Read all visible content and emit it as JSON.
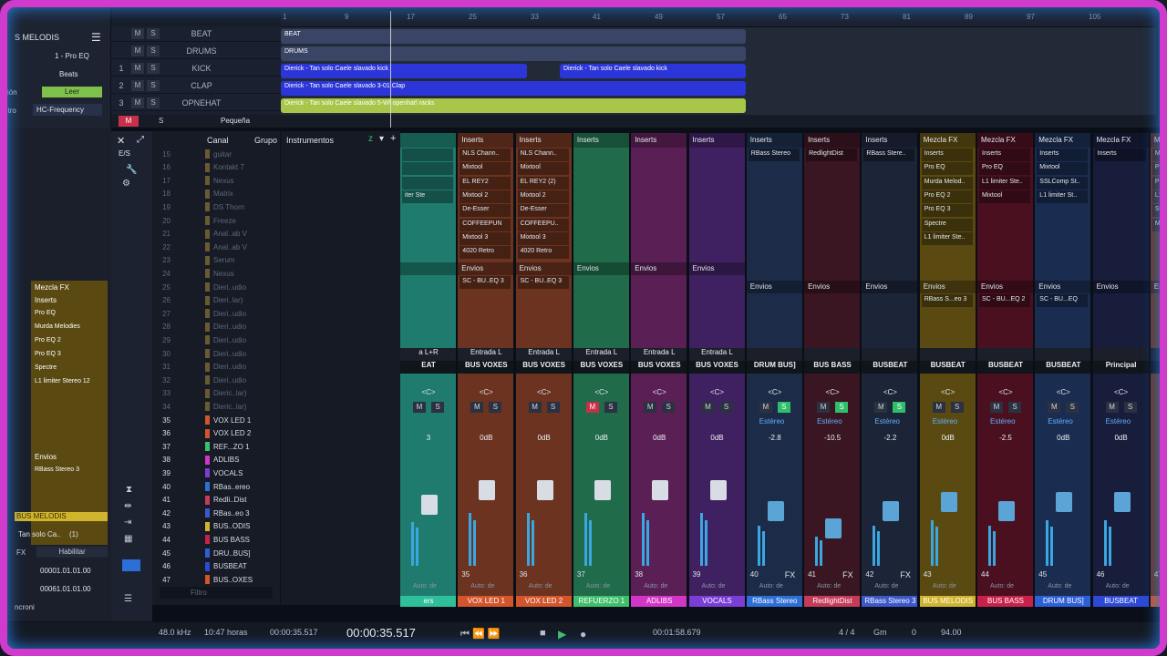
{
  "arrange": {
    "inspector": {
      "title": "S MELODIS",
      "preset": "1 - Pro EQ",
      "beats": "Beats",
      "leer": "Leer",
      "section": "ción",
      "freq_label": "etro",
      "freq": "HC-Frequency"
    },
    "tracks": [
      {
        "num": "",
        "name": "BEAT"
      },
      {
        "num": "",
        "name": "DRUMS"
      },
      {
        "num": "1",
        "name": "KICK"
      },
      {
        "num": "2",
        "name": "CLAP"
      },
      {
        "num": "3",
        "name": "OPNEHAT"
      }
    ],
    "small_label": "Pequeña",
    "ruler": [
      "1",
      "9",
      "17",
      "25",
      "33",
      "41",
      "49",
      "57",
      "65",
      "73",
      "81",
      "89",
      "97",
      "105"
    ],
    "clips": [
      {
        "label": "BEAT"
      },
      {
        "label": "DRUMS"
      },
      {
        "label": "Dierick - Tan solo Caele slavado kick"
      },
      {
        "label": "Dierick - Tan solo Caele slavado kick"
      },
      {
        "label": "Dierick - Tan solo Caele slavado 3-01 Clap"
      },
      {
        "label": "Dierick - Tan solo Caele slavado 5-W\\ openhat\\ racks"
      }
    ]
  },
  "browser": {
    "header": {
      "canal": "Canal",
      "grupo": "Grupo",
      "instrumentos": "Instrumentos"
    },
    "es": "E/S",
    "channels": [
      {
        "n": "15",
        "name": "guitar",
        "on": false,
        "color": "#6b5a2f"
      },
      {
        "n": "16",
        "name": "Kontakt 7",
        "on": false,
        "color": "#6b5a2f"
      },
      {
        "n": "17",
        "name": "Nexus",
        "on": false,
        "color": "#6b5a2f"
      },
      {
        "n": "18",
        "name": "Matrix",
        "on": false,
        "color": "#6b5a2f"
      },
      {
        "n": "19",
        "name": "DS Thorn",
        "on": false,
        "color": "#6b5a2f"
      },
      {
        "n": "20",
        "name": "Freeze",
        "on": false,
        "color": "#6b5a2f"
      },
      {
        "n": "21",
        "name": "Anal..ab V",
        "on": false,
        "color": "#6b5a2f"
      },
      {
        "n": "22",
        "name": "Anal..ab V",
        "on": false,
        "color": "#6b5a2f"
      },
      {
        "n": "23",
        "name": "Serum",
        "on": false,
        "color": "#6b5a2f"
      },
      {
        "n": "24",
        "name": "Nexus",
        "on": false,
        "color": "#6b5a2f"
      },
      {
        "n": "25",
        "name": "Dieri..udio",
        "on": false,
        "color": "#6b5a2f"
      },
      {
        "n": "26",
        "name": "Dieri..lar)",
        "on": false,
        "color": "#6b5a2f"
      },
      {
        "n": "27",
        "name": "Dieri..udio",
        "on": false,
        "color": "#6b5a2f"
      },
      {
        "n": "28",
        "name": "Dieri..udio",
        "on": false,
        "color": "#6b5a2f"
      },
      {
        "n": "29",
        "name": "Dieri..udio",
        "on": false,
        "color": "#6b5a2f"
      },
      {
        "n": "30",
        "name": "Dieri..udio",
        "on": false,
        "color": "#6b5a2f"
      },
      {
        "n": "31",
        "name": "Dieri..udio",
        "on": false,
        "color": "#6b5a2f"
      },
      {
        "n": "32",
        "name": "Dieri..udio",
        "on": false,
        "color": "#6b5a2f"
      },
      {
        "n": "33",
        "name": "Dieric..lar)",
        "on": false,
        "color": "#6b5a2f"
      },
      {
        "n": "34",
        "name": "Dieric..lar)",
        "on": false,
        "color": "#6b5a2f"
      },
      {
        "n": "35",
        "name": "VOX LED 1",
        "on": true,
        "color": "#d2552b"
      },
      {
        "n": "36",
        "name": "VOX LED 2",
        "on": true,
        "color": "#d2552b"
      },
      {
        "n": "37",
        "name": "REF...ZO 1",
        "on": true,
        "color": "#3fbf6c"
      },
      {
        "n": "38",
        "name": "ADLIBS",
        "on": true,
        "color": "#d336c7"
      },
      {
        "n": "39",
        "name": "VOCALS",
        "on": true,
        "color": "#7a3dd6"
      },
      {
        "n": "40",
        "name": "RBas..ereo",
        "on": true,
        "color": "#2d6fd6"
      },
      {
        "n": "41",
        "name": "Redli..Dist",
        "on": true,
        "color": "#c63a5a"
      },
      {
        "n": "42",
        "name": "RBas..eo 3",
        "on": true,
        "color": "#3b59c9"
      },
      {
        "n": "43",
        "name": "BUS..ODIS",
        "on": true,
        "color": "#d0b42d"
      },
      {
        "n": "44",
        "name": "BUS BASS",
        "on": true,
        "color": "#c8224a"
      },
      {
        "n": "45",
        "name": "DRU..BUS]",
        "on": true,
        "color": "#2d5fd6"
      },
      {
        "n": "46",
        "name": "BUSBEAT",
        "on": true,
        "color": "#2d49d6"
      },
      {
        "n": "47",
        "name": "BUS..OXES",
        "on": true,
        "color": "#d2552b"
      }
    ],
    "filter_placeholder": "Filtro",
    "fx": "FX",
    "aux": "AUX"
  },
  "left_fx": {
    "title": "Mezcla FX",
    "inserts": "Inserts",
    "items": [
      "Pro EQ",
      "Murda Melodies",
      "Pro EQ 2",
      "Pro EQ 3",
      "Spectre",
      "L1 limiter Stereo 12"
    ],
    "envios": "Envios",
    "send": "RBass Stereo 3",
    "bus": "BUS MELODIS",
    "clip": "Tan solo Ca..",
    "clip_count": "(1)",
    "fx": "FX",
    "habilitar": "Habilitar",
    "t1": "00001.01.01.00",
    "t2": "00061.01.01.00",
    "sync": "ncroni"
  },
  "strips": [
    {
      "color": "#1f7b6d",
      "hdr": "",
      "inserts": [
        "",
        "",
        "",
        "iter Ste"
      ],
      "envios": "",
      "sends": [],
      "input": "a L+R",
      "output": "EAT",
      "vol": "3",
      "num": "",
      "name": "ers",
      "fader": 0.6,
      "namebg": "#2fbf9a"
    },
    {
      "color": "#6b3320",
      "hdr": "Inserts",
      "inserts": [
        "NLS Chann..",
        "Mixtool",
        "EL REY2",
        "Mixtool 2",
        "De-Esser",
        "COFFEEPUN",
        "Mixtool 3",
        "4020 Retro"
      ],
      "envios": "Envios",
      "sends": [
        "SC - BU..EQ 3"
      ],
      "input": "Entrada L",
      "output": "BUS VOXES",
      "vol": "0dB",
      "num": "35",
      "name": "VOX LED 1",
      "fader": 0.72,
      "namebg": "#d2552b"
    },
    {
      "color": "#6b3320",
      "hdr": "Inserts",
      "inserts": [
        "NLS Chann..",
        "Mixtool",
        "EL REY2 (2)",
        "Mixtool 2",
        "De-Esser",
        "COFFEEPU..",
        "Mixtool 3",
        "4020 Retro"
      ],
      "envios": "Envios",
      "sends": [
        "SC - BU..EQ 3"
      ],
      "input": "Entrada L",
      "output": "BUS VOXES",
      "vol": "0dB",
      "num": "36",
      "name": "VOX LED 2",
      "fader": 0.72,
      "namebg": "#d2552b"
    },
    {
      "color": "#1f6b4a",
      "hdr": "Inserts",
      "inserts": [],
      "envios": "Envios",
      "sends": [],
      "input": "Entrada L",
      "output": "BUS VOXES",
      "vol": "0dB",
      "num": "37",
      "name": "REFUERZO 1",
      "fader": 0.72,
      "namebg": "#3fbf6c",
      "mute": true
    },
    {
      "color": "#5a1f55",
      "hdr": "Inserts",
      "inserts": [],
      "envios": "Envios",
      "sends": [],
      "input": "Entrada L",
      "output": "BUS VOXES",
      "vol": "0dB",
      "num": "38",
      "name": "ADLIBS",
      "fader": 0.72,
      "namebg": "#d336c7"
    },
    {
      "color": "#3f2060",
      "hdr": "Inserts",
      "inserts": [],
      "envios": "Envios",
      "sends": [],
      "input": "Entrada L",
      "output": "BUS VOXES",
      "vol": "0dB",
      "num": "39",
      "name": "VOCALS",
      "fader": 0.72,
      "namebg": "#7a3dd6"
    },
    {
      "color": "#1c2c48",
      "hdr": "Inserts",
      "inserts": [
        "RBass Stereo"
      ],
      "envios": "Envios",
      "sends": [],
      "input": "",
      "output": "DRUM BUS]",
      "vol": "-2.8",
      "num": "40",
      "name": "RBass Stereo",
      "fader": 0.55,
      "namebg": "#2d6fd6",
      "solo": true,
      "fx": "FX"
    },
    {
      "color": "#3a1622",
      "hdr": "Inserts",
      "inserts": [
        "RedlightDist"
      ],
      "envios": "Envios",
      "sends": [],
      "input": "",
      "output": "BUS BASS",
      "vol": "-10.5",
      "num": "41",
      "name": "RedlightDist",
      "fader": 0.4,
      "namebg": "#c63a5a",
      "solo": true,
      "fx": "FX"
    },
    {
      "color": "#1c2438",
      "hdr": "Inserts",
      "inserts": [
        "RBass Stere.."
      ],
      "envios": "Envios",
      "sends": [],
      "input": "",
      "output": "BUSBEAT",
      "vol": "-2.2",
      "num": "42",
      "name": "RBass Stereo 3",
      "fader": 0.55,
      "namebg": "#3b59c9",
      "solo": true,
      "fx": "FX"
    },
    {
      "color": "#5a4a12",
      "hdr": "Mezcla FX",
      "inserts": [
        "Inserts",
        "Pro EQ",
        "Murda Melod..",
        "Pro EQ 2",
        "Pro EQ 3",
        "Spectre",
        "L1 limiter Ste.."
      ],
      "envios": "Envios",
      "sends": [
        "RBass S...eo 3"
      ],
      "input": "",
      "output": "BUSBEAT",
      "vol": "0dB",
      "num": "43",
      "name": "BUS MELODIS",
      "fader": 0.62,
      "namebg": "#d0b42d"
    },
    {
      "color": "#4a1020",
      "hdr": "Mezcla FX",
      "inserts": [
        "Inserts",
        "Pro EQ",
        "L1 limiter Ste..",
        "Mixtool"
      ],
      "envios": "Envios",
      "sends": [
        "SC - BU...EQ 2"
      ],
      "input": "",
      "output": "BUSBEAT",
      "vol": "-2.5",
      "num": "44",
      "name": "BUS BASS",
      "fader": 0.55,
      "namebg": "#c8224a"
    },
    {
      "color": "#1a2d50",
      "hdr": "Mezcla FX",
      "inserts": [
        "Inserts",
        "Mixtool",
        "SSLComp St..",
        "L1 limiter St.."
      ],
      "envios": "Envios",
      "sends": [
        "SC - BU...EQ"
      ],
      "input": "",
      "output": "BUSBEAT",
      "vol": "0dB",
      "num": "45",
      "name": "DRUM BUS]",
      "fader": 0.62,
      "namebg": "#2d5fd6"
    },
    {
      "color": "#171d3a",
      "hdr": "Mezcla FX",
      "inserts": [
        "Inserts"
      ],
      "envios": "Envios",
      "sends": [],
      "input": "",
      "output": "Principal",
      "vol": "0dB",
      "num": "46",
      "name": "BUSBEAT",
      "fader": 0.62,
      "namebg": "#2d49d6"
    },
    {
      "color": "#6b3320",
      "hdr": "Mezcla FX",
      "inserts": [
        "Mixtoo",
        "Pro EQ",
        "Pro EQ",
        "L1 limi",
        "Studio",
        "Mixto"
      ],
      "envios": "Envio",
      "sends": [],
      "input": "",
      "output": "Princ",
      "vol": "",
      "num": "47",
      "name": "BUS VO",
      "fader": 0.62,
      "namebg": "#d2552b"
    }
  ],
  "strip_labels": {
    "mute": "M",
    "solo": "S",
    "pan": "<C>",
    "stereo": "Estéreo",
    "auto": "Auto: de"
  },
  "transport": {
    "rate": "48.0 kHz",
    "hours": "10:47 horas",
    "t_small": "00:00:35.517",
    "t_main": "00:00:35.517",
    "t_end": "00:01:58.679",
    "sig": "4 / 4",
    "key": "Gm",
    "zero": "0",
    "tempo": "94.00"
  }
}
